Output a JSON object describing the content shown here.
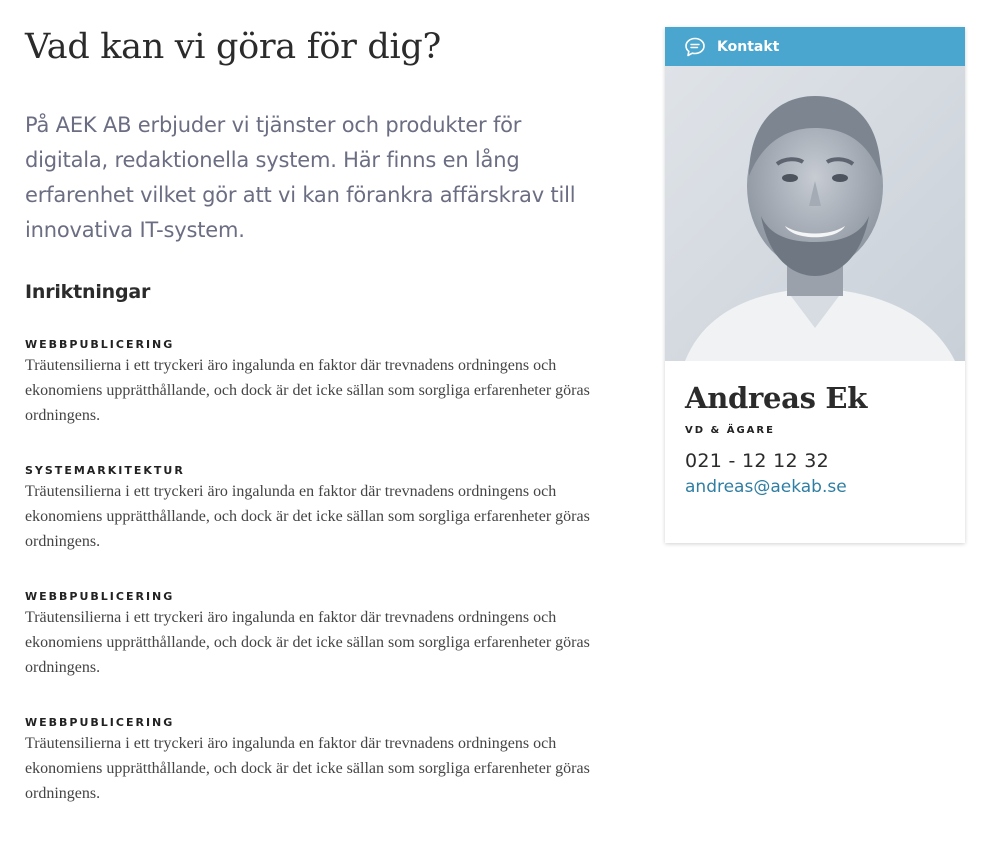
{
  "main": {
    "title": "Vad kan vi göra för dig?",
    "intro": "På AEK AB erbjuder vi tjänster och produkter för digitala, redaktionella system. Här finns en lång erfarenhet vilket gör att vi kan förankra affärskrav till innovativa IT-system.",
    "section_heading": "Inriktningar",
    "services": [
      {
        "title": "WEBBPUBLICERING",
        "text": "Träutensilierna i ett tryckeri äro ingalunda en faktor där trevnadens ordningens och ekonomiens upprätthållande, och dock är det icke sällan som sorgliga erfarenheter göras ordningens."
      },
      {
        "title": "SYSTEMARKITEKTUR",
        "text": "Träutensilierna i ett tryckeri äro ingalunda en faktor där trevnadens ordningens och ekonomiens upprätthållande, och dock är det icke sällan som sorgliga erfarenheter göras ordningens."
      },
      {
        "title": "WEBBPUBLICERING",
        "text": "Träutensilierna i ett tryckeri äro ingalunda en faktor där trevnadens ordningens och ekonomiens upprätthållande, och dock är det icke sällan som sorgliga erfarenheter göras ordningens."
      },
      {
        "title": "WEBBPUBLICERING",
        "text": "Träutensilierna i ett tryckeri äro ingalunda en faktor där trevnadens ordningens och ekonomiens upprätthållande, och dock är det icke sällan som sorgliga erfarenheter göras ordningens."
      }
    ]
  },
  "contact": {
    "header_label": "Kontakt",
    "header_icon": "chat-bubble-icon",
    "name": "Andreas Ek",
    "role": "VD & ÄGARE",
    "phone": "021 - 12 12 32",
    "email": "andreas@aekab.se"
  },
  "colors": {
    "accent": "#4aa6cf",
    "link": "#2f7ea3",
    "intro_text": "#6b6d82"
  }
}
